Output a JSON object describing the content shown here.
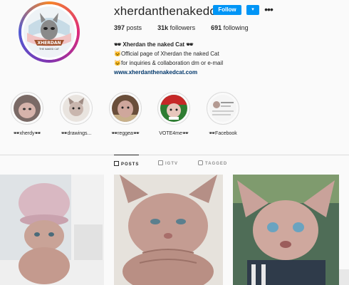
{
  "profile": {
    "username": "xherdanthenakedcat",
    "follow_label": "Follow",
    "dropdown_icon": "chevron-down-icon",
    "more_icon": "more-options-icon",
    "avatar_text": "XHERDAN",
    "avatar_subtext": "THE NAKED CAT"
  },
  "stats": {
    "posts_count": "397",
    "posts_label": "posts",
    "followers_count": "31k",
    "followers_label": "followers",
    "following_count": "691",
    "following_label": "following"
  },
  "bio": {
    "name": "🕶 Xherdan the naked Cat 🕶",
    "line1": "🐱Official page of Xherdan the naked Cat",
    "line2": "🐱for inquiries & collaboration dm or e-mail",
    "link": "www.xherdanthenakedcat.com"
  },
  "highlights": [
    {
      "label": "🕶xherdy🕶"
    },
    {
      "label": "🕶drawings..."
    },
    {
      "label": "🕶reggea🕶"
    },
    {
      "label": "VOTE4me🕶"
    },
    {
      "label": "🕶Facebook"
    }
  ],
  "tabs": [
    {
      "label": "POSTS",
      "icon": "grid-icon"
    },
    {
      "label": "IGTV",
      "icon": "tv-icon"
    },
    {
      "label": "TAGGED",
      "icon": "tag-icon"
    }
  ],
  "colors": {
    "accent": "#0095f6",
    "link": "#00376b",
    "text": "#262626",
    "muted": "#8e8e8e"
  }
}
